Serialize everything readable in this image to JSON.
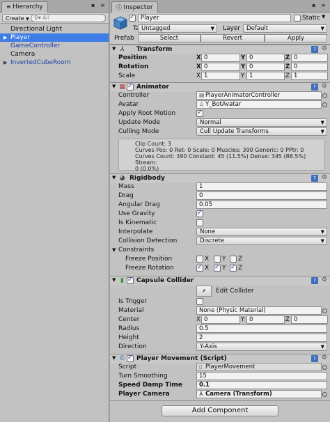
{
  "hierarchy": {
    "tab_label": "Hierarchy",
    "create_label": "Create",
    "search_placeholder": "All",
    "items": [
      {
        "label": "Directional Light"
      },
      {
        "label": "Player"
      },
      {
        "label": "GameController"
      },
      {
        "label": "Camera"
      },
      {
        "label": "InvertedCubeRoom"
      }
    ]
  },
  "inspector": {
    "tab_label": "Inspector",
    "object_name": "Player",
    "static_label": "Static",
    "tag_label": "Tag",
    "tag_value": "Untagged",
    "layer_label": "Layer",
    "layer_value": "Default",
    "prefab_label": "Prefab",
    "prefab_buttons": [
      "Select",
      "Revert",
      "Apply"
    ]
  },
  "transform": {
    "title": "Transform",
    "rows": [
      {
        "label": "Position",
        "x": "0",
        "y": "0",
        "z": "0"
      },
      {
        "label": "Rotation",
        "x": "0",
        "y": "0",
        "z": "0"
      },
      {
        "label": "Scale",
        "x": "1",
        "y": "1",
        "z": "1"
      }
    ]
  },
  "animator": {
    "title": "Animator",
    "controller_label": "Controller",
    "controller_value": "PlayerAnimatorController",
    "avatar_label": "Avatar",
    "avatar_value": "Y_BotAvatar",
    "root_motion_label": "Apply Root Motion",
    "update_mode_label": "Update Mode",
    "update_mode_value": "Normal",
    "culling_mode_label": "Culling Mode",
    "culling_mode_value": "Cull Update Transforms",
    "info_lines": [
      "Clip Count: 3",
      "Curves Pos: 0 Rot: 0 Scale: 0 Muscles: 390 Generic: 0 PPtr: 0",
      "Curves Count: 390 Constant: 45 (11.5%) Dense: 345 (88.5%) Stream:",
      "0 (0.0%)"
    ]
  },
  "rigidbody": {
    "title": "Rigidbody",
    "mass_label": "Mass",
    "mass_value": "1",
    "drag_label": "Drag",
    "drag_value": "0",
    "angular_drag_label": "Angular Drag",
    "angular_drag_value": "0.05",
    "use_gravity_label": "Use Gravity",
    "is_kinematic_label": "Is Kinematic",
    "interpolate_label": "Interpolate",
    "interpolate_value": "None",
    "collision_label": "Collision Detection",
    "collision_value": "Discrete",
    "constraints_label": "Constraints",
    "freeze_position_label": "Freeze Position",
    "freeze_rotation_label": "Freeze Rotation",
    "axes": [
      "X",
      "Y",
      "Z"
    ]
  },
  "capsule": {
    "title": "Capsule Collider",
    "edit_label": "Edit Collider",
    "trigger_label": "Is Trigger",
    "material_label": "Material",
    "material_value": "None (Physic Material)",
    "center_label": "Center",
    "center_x": "0",
    "center_y": "0",
    "center_z": "0",
    "radius_label": "Radius",
    "radius_value": "0.5",
    "height_label": "Height",
    "height_value": "2",
    "direction_label": "Direction",
    "direction_value": "Y-Axis"
  },
  "movement": {
    "title": "Player Movement (Script)",
    "script_label": "Script",
    "script_value": "PlayerMovement",
    "turn_label": "Turn Smoothing",
    "turn_value": "15",
    "speed_label": "Speed Damp Time",
    "speed_value": "0.1",
    "camera_label": "Player Camera",
    "camera_value": "Camera (Transform)"
  },
  "add_component_label": "Add Component",
  "colors": {
    "selection": "#3e7ce8",
    "panel": "#c2c2c2",
    "link_blue": "#1f3fa8",
    "help_icon": "#3e6fb8"
  }
}
